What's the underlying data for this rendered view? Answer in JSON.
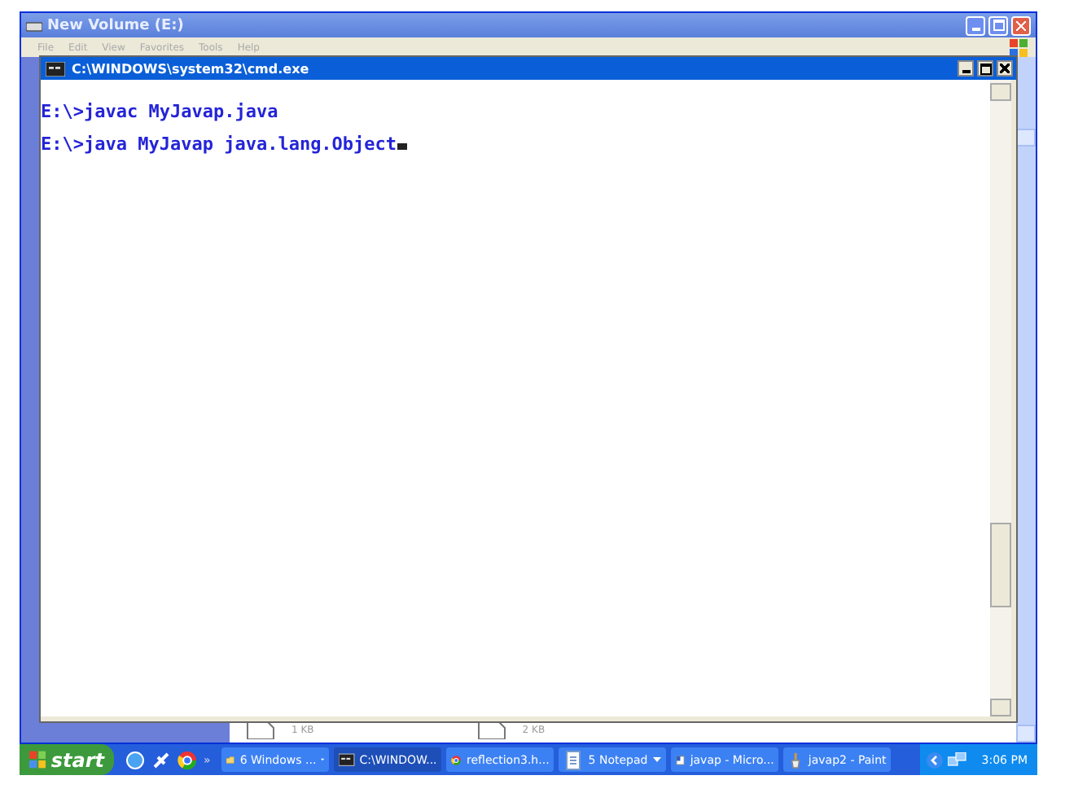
{
  "explorer": {
    "title": "New Volume (E:)",
    "menu": [
      "File",
      "Edit",
      "View",
      "Favorites",
      "Tools",
      "Help"
    ],
    "files": [
      {
        "size": "1 KB"
      },
      {
        "size": "2 KB"
      }
    ]
  },
  "console": {
    "title": "C:\\WINDOWS\\system32\\cmd.exe",
    "lines": [
      "E:\\>javac MyJavap.java",
      "E:\\>java MyJavap java.lang.Object"
    ]
  },
  "taskbar": {
    "start": "start",
    "more": "»",
    "clock": "3:06 PM",
    "buttons": [
      {
        "kind": "folder",
        "label": "6 Windows ...",
        "selected": false,
        "grouped": true
      },
      {
        "kind": "console",
        "label": "C:\\WINDOW...",
        "selected": true,
        "grouped": false
      },
      {
        "kind": "browser",
        "label": "reflection3.h...",
        "selected": false,
        "grouped": false
      },
      {
        "kind": "notepad",
        "label": "5 Notepad",
        "selected": false,
        "grouped": true
      },
      {
        "kind": "document",
        "label": "javap - Micro...",
        "selected": false,
        "grouped": false
      },
      {
        "kind": "paint",
        "label": "javap2 - Paint",
        "selected": false,
        "grouped": false
      }
    ]
  }
}
